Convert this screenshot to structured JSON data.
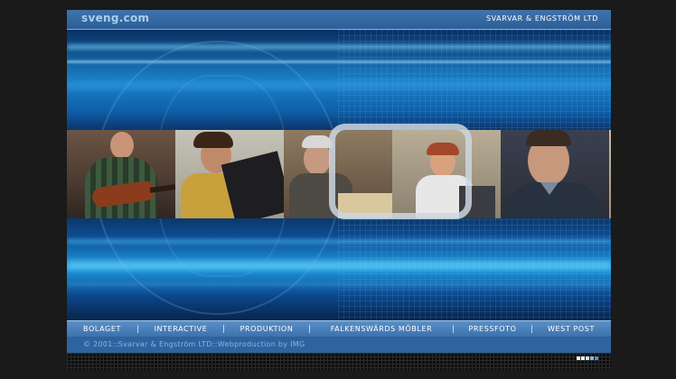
{
  "header": {
    "logo": "sveng.com",
    "company": "SVARVAR & ENGSTRÖM LTD"
  },
  "nav": {
    "items": [
      {
        "label": "BOLAGET"
      },
      {
        "label": "INTERACTIVE"
      },
      {
        "label": "PRODUKTION"
      },
      {
        "label": "FALKENSWÄRDS MÖBLER"
      },
      {
        "label": "PRESSFOTO"
      },
      {
        "label": "WEST POST"
      }
    ]
  },
  "footer": {
    "copyright": "© 2001::Svarvar & Engström LTD::Webproduction by IMG"
  },
  "colors": {
    "page_bg": "#1a1a1a",
    "bar_blue": "#3f73ab",
    "nav_blue": "#4f84bd",
    "logo_text": "#a9ceef",
    "hero_cyan": "#1e9adf"
  },
  "icons": [
    "tv-frame-icon",
    "page-indicator-icon"
  ]
}
